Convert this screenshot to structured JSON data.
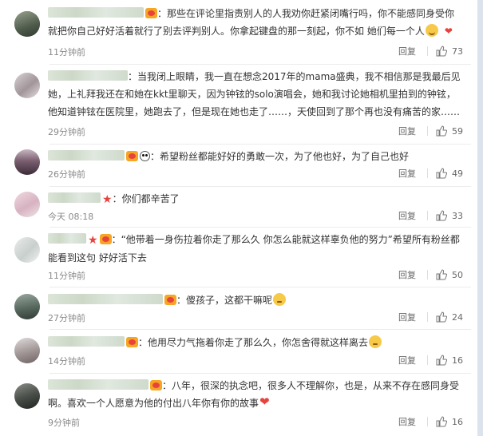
{
  "comments": [
    {
      "text": "那些在评论里指责别人的人我劝你赶紧闭嘴行吗，你不能感同身受你就把你自己好好活着就行了别去评判别人。你拿起键盘的那一刻起，你不如 她们每一个人",
      "time": "11分钟前",
      "reply": "回复",
      "likes": "73",
      "badges": [
        "vip"
      ],
      "emoji": "smile",
      "trailing_mark": "❤"
    },
    {
      "text": "当我闭上眼睛，我一直在想念2017年的mama盛典，我不相信那是我最后见她，上礼拜我还在和她在kkt里聊天，因为钟铉的solo演唱会，她和我讨论她相机里拍到的钟铉，他知道钟铉在医院里，她跑去了，但是现在她也走了……，天使回到了那个再也没有痛苦的家……",
      "time": "29分钟前",
      "reply": "回复",
      "likes": "59",
      "badges": []
    },
    {
      "text": "希望粉丝都能好好的勇敢一次，为了他也好，为了自己也好",
      "time": "26分钟前",
      "reply": "回复",
      "likes": "49",
      "badges": [
        "vip",
        "panda"
      ]
    },
    {
      "text": "你们都辛苦了",
      "time": "今天 08:18",
      "reply": "回复",
      "likes": "33",
      "badges": [
        "star"
      ]
    },
    {
      "text": "“他带着一身伤拉着你走了那么久 你怎么能就这样辜负他的努力”希望所有粉丝都能看到这句 好好活下去",
      "time": "11分钟前",
      "reply": "回复",
      "likes": "50",
      "badges": [
        "star",
        "vip"
      ]
    },
    {
      "text": "傻孩子，这都干嘛呢",
      "time": "27分钟前",
      "reply": "回复",
      "likes": "24",
      "badges": [
        "vip"
      ],
      "emoji": "relieved"
    },
    {
      "text": "他用尽力气拖着你走了那么久，你怎舍得就这样离去",
      "time": "14分钟前",
      "reply": "回复",
      "likes": "16",
      "badges": [
        "vip"
      ],
      "emoji": "relieved"
    },
    {
      "text": "八年，很深的执念吧，很多人不理解你，也是，从来不存在感同身受啊。喜欢一个人愿意为他的付出八年你有你的故事",
      "time": "9分钟前",
      "reply": "回复",
      "likes": "16",
      "badges": [
        "vip"
      ],
      "emoji": "heart"
    }
  ],
  "colors": {
    "vip": "#f6a623",
    "star": "#e8423d",
    "meta": "#8a8a8a"
  },
  "icons": {
    "like": "thumbs-up-icon"
  }
}
